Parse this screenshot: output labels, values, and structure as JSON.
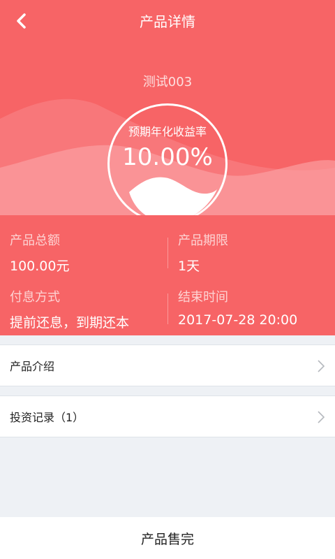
{
  "topbar": {
    "title": "产品详情"
  },
  "product": {
    "name": "测试003",
    "rate_label": "预期年化收益率",
    "rate_value": "10.00%"
  },
  "info": {
    "total_label": "产品总额",
    "total_value": "100.00元",
    "term_label": "产品期限",
    "term_value": "1天",
    "interest_label": "付息方式",
    "interest_value": "提前还息，到期还本",
    "end_label": "结束时间",
    "end_value": "2017-07-28 20:00"
  },
  "rows": [
    {
      "label": "产品介绍"
    },
    {
      "label": "投资记录（1）"
    }
  ],
  "footer": {
    "status": "产品售完"
  },
  "colors": {
    "accent": "#f76466",
    "background": "#eef1f5"
  }
}
